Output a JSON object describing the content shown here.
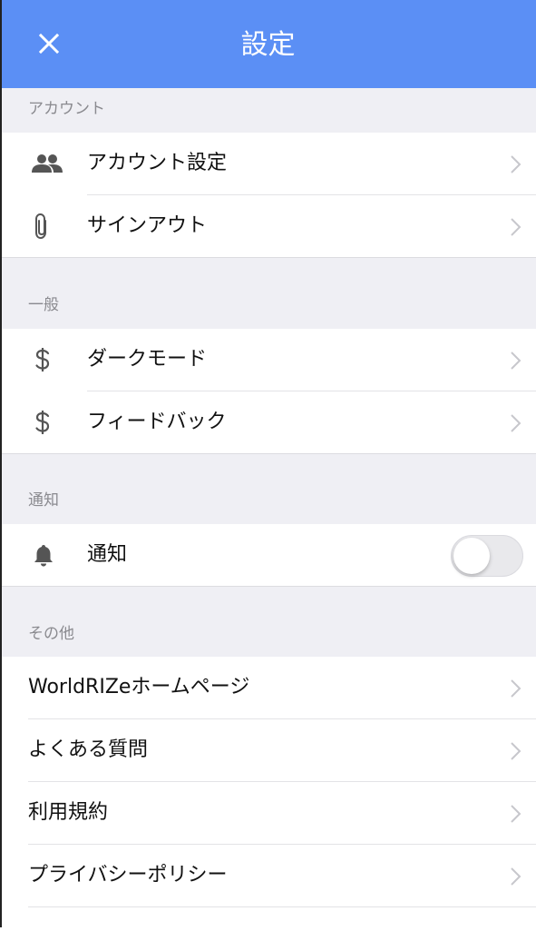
{
  "nav": {
    "title": "設定",
    "close_icon": "close-icon"
  },
  "sections": {
    "account": {
      "header": "アカウント",
      "items": [
        {
          "label": "アカウント設定",
          "icon": "people-icon"
        },
        {
          "label": "サインアウト",
          "icon": "paperclip-icon"
        }
      ]
    },
    "general": {
      "header": "一般",
      "items": [
        {
          "label": "ダークモード",
          "icon": "dollar-icon"
        },
        {
          "label": "フィードバック",
          "icon": "dollar-icon"
        }
      ]
    },
    "notify": {
      "header": "通知",
      "items": [
        {
          "label": "通知",
          "icon": "bell-icon",
          "toggle_on": false
        }
      ]
    },
    "other": {
      "header": "その他",
      "items": [
        {
          "label": "WorldRIZeホームページ"
        },
        {
          "label": "よくある質問"
        },
        {
          "label": "利用規約"
        },
        {
          "label": "プライバシーポリシー"
        }
      ]
    }
  },
  "colors": {
    "nav_bg": "#5b8ff5",
    "page_bg": "#efeff4",
    "chevron": "#c7c7cc"
  }
}
